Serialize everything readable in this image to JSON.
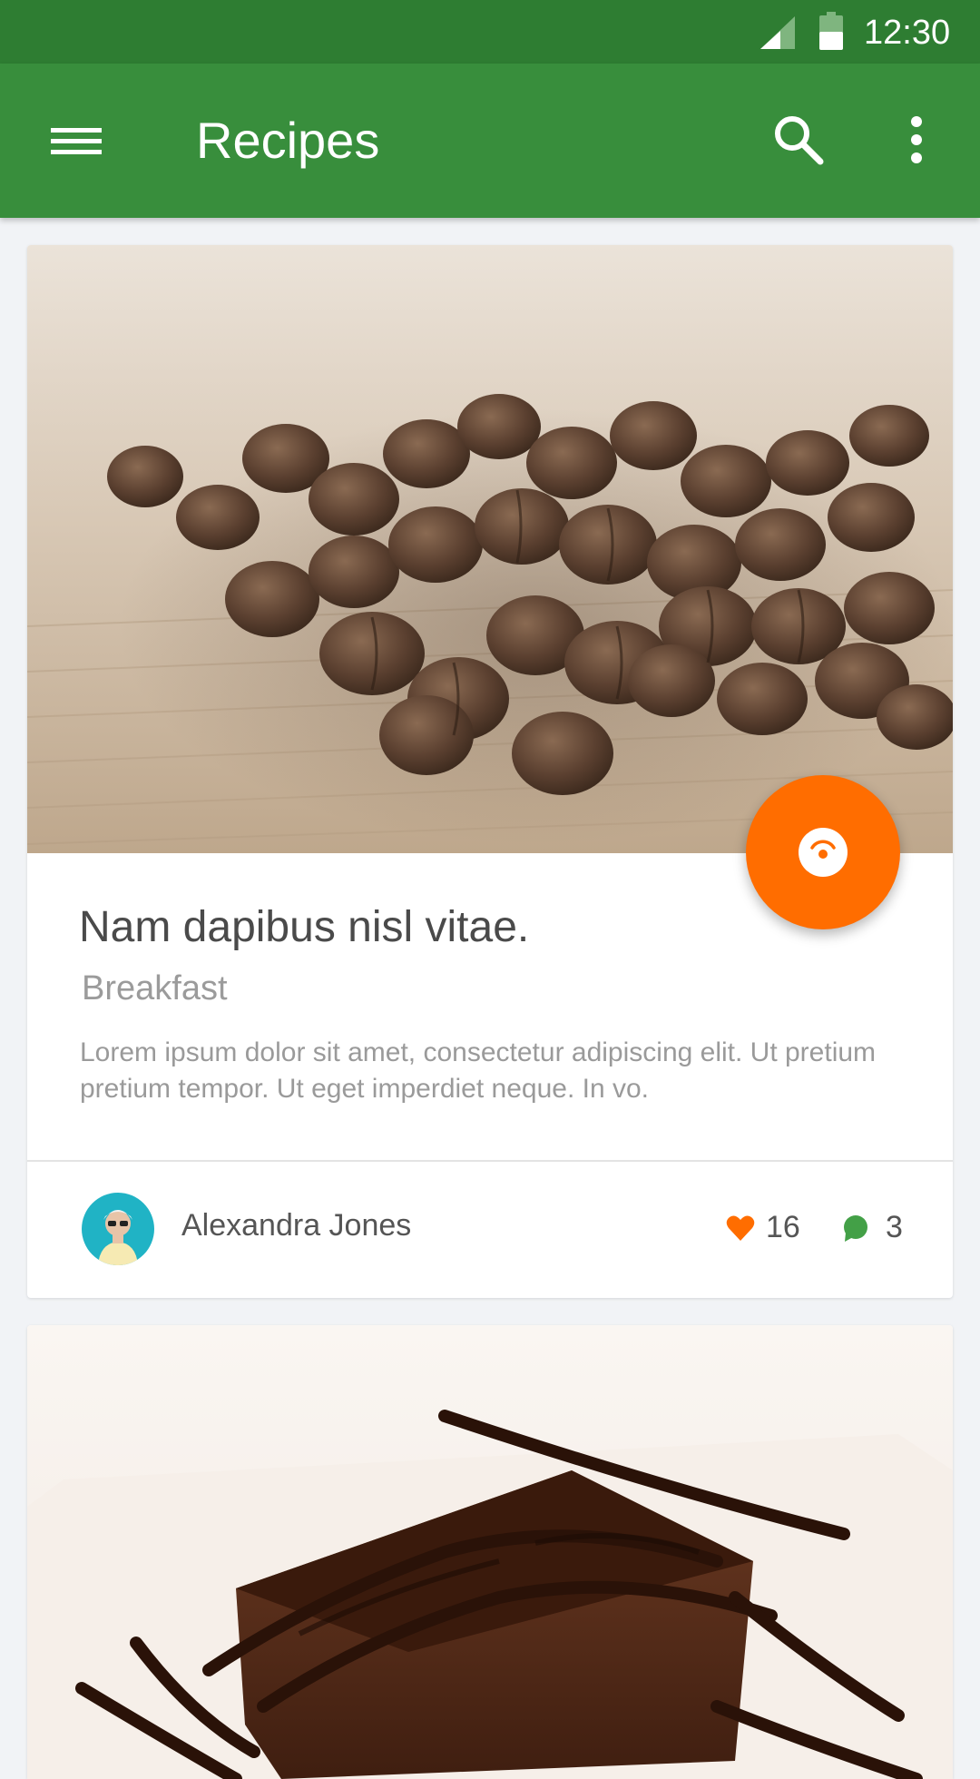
{
  "status_bar": {
    "time": "12:30",
    "icons": [
      "signal-icon",
      "battery-icon"
    ]
  },
  "app_bar": {
    "title": "Recipes",
    "icons": [
      "menu-icon",
      "search-icon",
      "more-vert-icon"
    ]
  },
  "recipes": [
    {
      "title": "Nam dapibus nisl vitae.",
      "category": "Breakfast",
      "description": "Lorem ipsum dolor sit amet, consectetur adipiscing elit. Ut pretium pretium tempor. Ut eget imperdiet neque. In vo.",
      "image": "coffee-beans-photo",
      "author": "Alexandra Jones",
      "likes": "16",
      "comments": "3",
      "fab_icon": "disc-icon"
    },
    {
      "image": "chocolate-cake-photo"
    }
  ],
  "colors": {
    "status_bar": "#2e7d32",
    "app_bar": "#388e3c",
    "fab": "#ff6d00",
    "heart": "#ff6d00",
    "comment": "#43a047",
    "background": "#f1f3f6"
  }
}
